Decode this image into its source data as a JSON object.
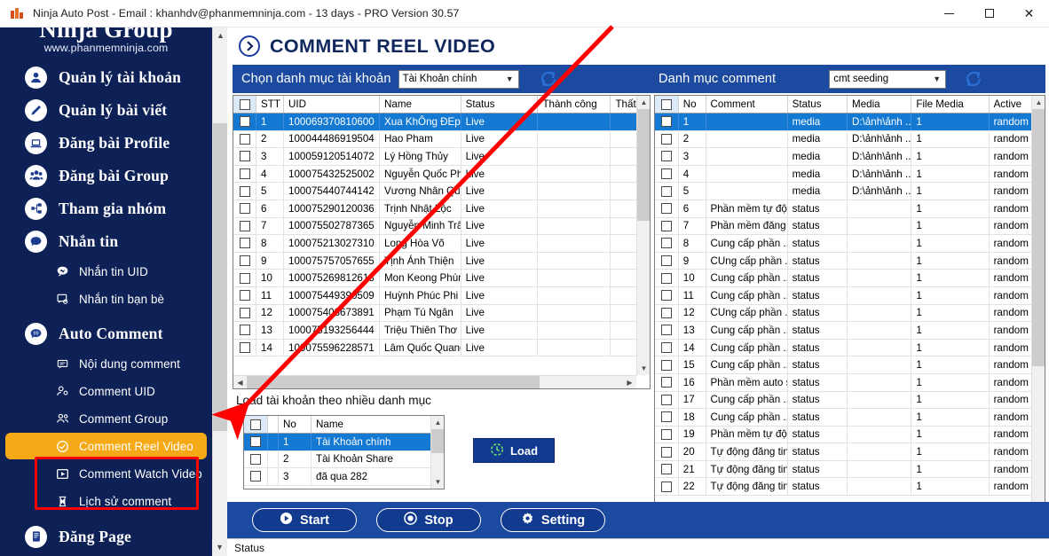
{
  "titlebar": {
    "app_icon": "ninja-app-icon",
    "text": "Ninja Auto Post - Email : khanhdv@phanmemninja.com - 13 days -  PRO Version 30.57",
    "minimize": "–",
    "maximize": "□",
    "close": "✕"
  },
  "sidebar": {
    "brand_name": "Ninja Group",
    "brand_url": "www.phanmemninja.com",
    "main_items": [
      {
        "label": "Quản lý tài khoản",
        "icon": "user-icon"
      },
      {
        "label": "Quản lý bài viết",
        "icon": "pencil-icon"
      },
      {
        "label": "Đăng bài Profile",
        "icon": "laptop-icon"
      },
      {
        "label": "Đăng bài Group",
        "icon": "group-icon"
      },
      {
        "label": "Tham gia nhóm",
        "icon": "share-nodes-icon"
      },
      {
        "label": "Nhắn tin",
        "icon": "chat-icon"
      }
    ],
    "messaging_subitems": [
      {
        "label": "Nhắn tin UID",
        "icon": "message-bubble-icon"
      },
      {
        "label": "Nhắn tin bạn bè",
        "icon": "message-friends-icon"
      }
    ],
    "auto_comment": {
      "label": "Auto Comment",
      "icon": "comment-icon"
    },
    "auto_comment_subitems": [
      {
        "label": "Nội dung comment",
        "icon": "comment-content-icon",
        "active": false
      },
      {
        "label": "Comment UID",
        "icon": "comment-uid-icon",
        "active": false
      },
      {
        "label": "Comment Group",
        "icon": "comment-group-icon",
        "active": false
      },
      {
        "label": "Comment Reel Video",
        "icon": "check-circle-icon",
        "active": true
      },
      {
        "label": "Comment Watch Video",
        "icon": "play-box-icon",
        "active": false
      },
      {
        "label": "Lịch sử comment",
        "icon": "hourglass-icon",
        "active": false
      }
    ],
    "page_item": {
      "label": "Đăng Page",
      "icon": "page-icon"
    },
    "active_highlight_color": "#f5a916",
    "annotation_box_color": "#ff0000"
  },
  "main": {
    "page_title": "COMMENT REEL VIDEO",
    "page_title_icon": "chevron-right-circle-icon"
  },
  "account_panel": {
    "label": "Chọn danh mục tài khoản",
    "dropdown_value": "Tài Khoản chính",
    "refresh_icon": "refresh-icon",
    "columns": [
      "",
      "STT",
      "UID",
      "Name",
      "Status",
      "Thành công",
      "Thất b"
    ],
    "rows": [
      {
        "stt": "1",
        "uid": "100069370810600",
        "name": "Xua KhÔng ĐEp",
        "status": "Live",
        "thanh_cong": "",
        "that_bai": "",
        "selected": true
      },
      {
        "stt": "2",
        "uid": "100044486919504",
        "name": "Hao Pham",
        "status": "Live",
        "thanh_cong": "",
        "that_bai": "",
        "selected": false
      },
      {
        "stt": "3",
        "uid": "100059120514072",
        "name": "Lý Hồng Thủy",
        "status": "Live",
        "thanh_cong": "",
        "that_bai": "",
        "selected": false
      },
      {
        "stt": "4",
        "uid": "100075432525002",
        "name": "Nguyễn Quốc Phi",
        "status": "Live",
        "thanh_cong": "",
        "that_bai": "",
        "selected": false
      },
      {
        "stt": "5",
        "uid": "100075440744142",
        "name": "Vương Nhân Quy...",
        "status": "Live",
        "thanh_cong": "",
        "that_bai": "",
        "selected": false
      },
      {
        "stt": "6",
        "uid": "100075290120036",
        "name": "Trịnh Nhật Lộc",
        "status": "Live",
        "thanh_cong": "",
        "that_bai": "",
        "selected": false
      },
      {
        "stt": "7",
        "uid": "100075502787365",
        "name": "Nguyễn Minh Trâm",
        "status": "Live",
        "thanh_cong": "",
        "that_bai": "",
        "selected": false
      },
      {
        "stt": "8",
        "uid": "100075213027310",
        "name": "Long Hòa Võ",
        "status": "Live",
        "thanh_cong": "",
        "that_bai": "",
        "selected": false
      },
      {
        "stt": "9",
        "uid": "100075757057655",
        "name": "Tịnh Ánh Thiện",
        "status": "Live",
        "thanh_cong": "",
        "that_bai": "",
        "selected": false
      },
      {
        "stt": "10",
        "uid": "100075269812618",
        "name": "Mon Keong Phùng",
        "status": "Live",
        "thanh_cong": "",
        "that_bai": "",
        "selected": false
      },
      {
        "stt": "11",
        "uid": "100075449390509",
        "name": "Huỳnh Phúc Phi",
        "status": "Live",
        "thanh_cong": "",
        "that_bai": "",
        "selected": false
      },
      {
        "stt": "12",
        "uid": "100075408673891",
        "name": "Phạm Tú Ngân",
        "status": "Live",
        "thanh_cong": "",
        "that_bai": "",
        "selected": false
      },
      {
        "stt": "13",
        "uid": "100075193256444",
        "name": "Triệu Thiên Thơ",
        "status": "Live",
        "thanh_cong": "",
        "that_bai": "",
        "selected": false
      },
      {
        "stt": "14",
        "uid": "100075596228571",
        "name": "Lâm Quốc Quang",
        "status": "Live",
        "thanh_cong": "",
        "that_bai": "",
        "selected": false
      }
    ]
  },
  "comment_panel": {
    "label": "Danh mục comment",
    "dropdown_value": "cmt seeding",
    "refresh_icon": "refresh-icon",
    "columns": [
      "",
      "No",
      "Comment",
      "Status",
      "Media",
      "File Media",
      "Active"
    ],
    "rows": [
      {
        "no": "1",
        "comment": "",
        "status": "media",
        "media": "D:\\ảnh\\ảnh ...",
        "file_media": "1",
        "active": "random",
        "selected": true
      },
      {
        "no": "2",
        "comment": "",
        "status": "media",
        "media": "D:\\ảnh\\ảnh ...",
        "file_media": "1",
        "active": "random",
        "selected": false
      },
      {
        "no": "3",
        "comment": "",
        "status": "media",
        "media": "D:\\ảnh\\ảnh ...",
        "file_media": "1",
        "active": "random",
        "selected": false
      },
      {
        "no": "4",
        "comment": "",
        "status": "media",
        "media": "D:\\ảnh\\ảnh ...",
        "file_media": "1",
        "active": "random",
        "selected": false
      },
      {
        "no": "5",
        "comment": "",
        "status": "media",
        "media": "D:\\ảnh\\ảnh ...",
        "file_media": "1",
        "active": "random",
        "selected": false
      },
      {
        "no": "6",
        "comment": "Phần mềm tự độ...",
        "status": "status",
        "media": "",
        "file_media": "1",
        "active": "random",
        "selected": false
      },
      {
        "no": "7",
        "comment": "Phần mềm đăng ...",
        "status": "status",
        "media": "",
        "file_media": "1",
        "active": "random",
        "selected": false
      },
      {
        "no": "8",
        "comment": "Cung cấp phần ...",
        "status": "status",
        "media": "",
        "file_media": "1",
        "active": "random",
        "selected": false
      },
      {
        "no": "9",
        "comment": "CUng cấp phần ...",
        "status": "status",
        "media": "",
        "file_media": "1",
        "active": "random",
        "selected": false
      },
      {
        "no": "10",
        "comment": "Cung cấp phần ...",
        "status": "status",
        "media": "",
        "file_media": "1",
        "active": "random",
        "selected": false
      },
      {
        "no": "11",
        "comment": "Cung cấp phần ...",
        "status": "status",
        "media": "",
        "file_media": "1",
        "active": "random",
        "selected": false
      },
      {
        "no": "12",
        "comment": "CUng cấp phần ...",
        "status": "status",
        "media": "",
        "file_media": "1",
        "active": "random",
        "selected": false
      },
      {
        "no": "13",
        "comment": "Cung cấp phần ...",
        "status": "status",
        "media": "",
        "file_media": "1",
        "active": "random",
        "selected": false
      },
      {
        "no": "14",
        "comment": "Cung cấp phần ...",
        "status": "status",
        "media": "",
        "file_media": "1",
        "active": "random",
        "selected": false
      },
      {
        "no": "15",
        "comment": "Cung cấp phần ...",
        "status": "status",
        "media": "",
        "file_media": "1",
        "active": "random",
        "selected": false
      },
      {
        "no": "16",
        "comment": "Phần mềm auto s...",
        "status": "status",
        "media": "",
        "file_media": "1",
        "active": "random",
        "selected": false
      },
      {
        "no": "17",
        "comment": "Cung cấp phần ...",
        "status": "status",
        "media": "",
        "file_media": "1",
        "active": "random",
        "selected": false
      },
      {
        "no": "18",
        "comment": "Cung cấp phần ...",
        "status": "status",
        "media": "",
        "file_media": "1",
        "active": "random",
        "selected": false
      },
      {
        "no": "19",
        "comment": "Phần mềm tự độ...",
        "status": "status",
        "media": "",
        "file_media": "1",
        "active": "random",
        "selected": false
      },
      {
        "no": "20",
        "comment": "Tự động đăng tin...",
        "status": "status",
        "media": "",
        "file_media": "1",
        "active": "random",
        "selected": false
      },
      {
        "no": "21",
        "comment": "Tự động đăng tin...",
        "status": "status",
        "media": "",
        "file_media": "1",
        "active": "random",
        "selected": false
      },
      {
        "no": "22",
        "comment": "Tự động đăng tin...",
        "status": "status",
        "media": "",
        "file_media": "1",
        "active": "random",
        "selected": false
      }
    ]
  },
  "category_panel": {
    "label": "Load tài khoản theo nhiều danh mục",
    "columns": [
      "",
      "No",
      "Name"
    ],
    "rows": [
      {
        "no": "1",
        "name": "Tài Khoản chính",
        "selected": true
      },
      {
        "no": "2",
        "name": "Tài Khoản Share",
        "selected": false
      },
      {
        "no": "3",
        "name": "đã qua 282",
        "selected": false
      }
    ],
    "load_button": {
      "label": "Load",
      "icon": "load-clock-icon"
    }
  },
  "actions": {
    "start": {
      "label": "Start",
      "icon": "play-icon"
    },
    "stop": {
      "label": "Stop",
      "icon": "record-icon"
    },
    "setting": {
      "label": "Setting",
      "icon": "gear-icon"
    }
  },
  "statusbar": {
    "label": "Status"
  },
  "annotation": {
    "arrow_color": "#ff0000"
  }
}
